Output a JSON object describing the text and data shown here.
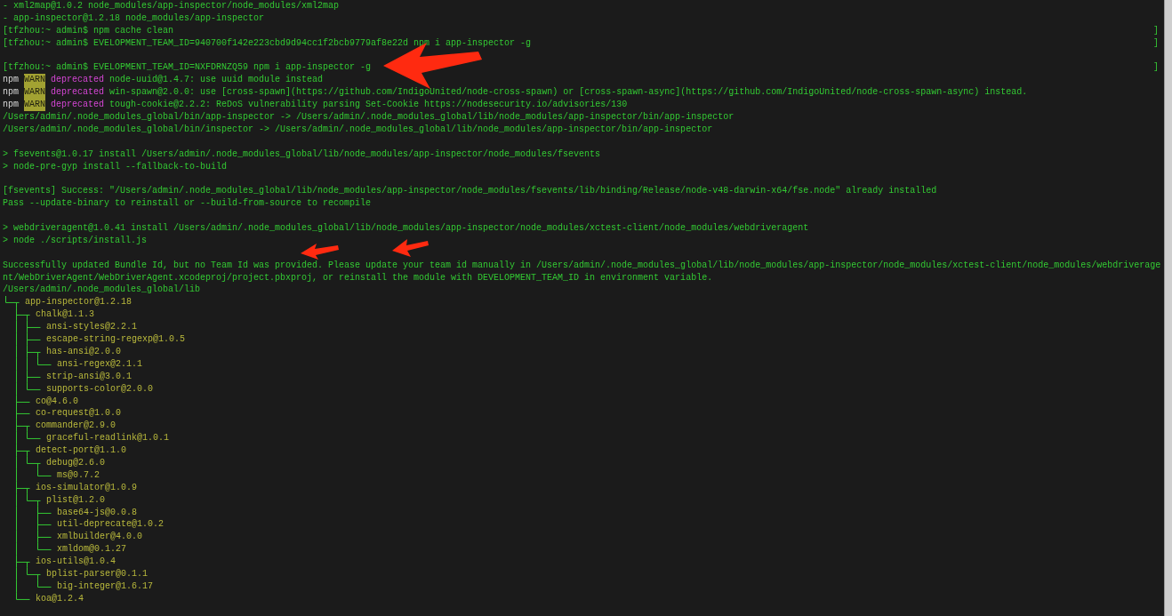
{
  "terminal": {
    "lines": [
      {
        "kind": "output",
        "text": "- xml2map@1.0.2 node_modules/app-inspector/node_modules/xml2map"
      },
      {
        "kind": "output",
        "text": "- app-inspector@1.2.18 node_modules/app-inspector"
      },
      {
        "kind": "prompt",
        "text": "[tfzhou:~ admin$ npm cache clean",
        "edge_mark": "]"
      },
      {
        "kind": "prompt",
        "text": "[tfzhou:~ admin$ EVELOPMENT_TEAM_ID=940700f142e223cbd9d94cc1f2bcb9779af8e22d npm i app-inspector -g",
        "edge_mark": "]"
      },
      {
        "kind": "blank"
      },
      {
        "kind": "prompt",
        "text": "[tfzhou:~ admin$ EVELOPMENT_TEAM_ID=NXFDRNZQ59 npm i app-inspector -g",
        "edge_mark": "]"
      },
      {
        "kind": "warn",
        "source": "npm",
        "level": "WARN",
        "tag": "deprecated",
        "text": "node-uuid@1.4.7: use uuid module instead"
      },
      {
        "kind": "warn",
        "source": "npm",
        "level": "WARN",
        "tag": "deprecated",
        "text": "win-spawn@2.0.0: use [cross-spawn](https://github.com/IndigoUnited/node-cross-spawn) or [cross-spawn-async](https://github.com/IndigoUnited/node-cross-spawn-async) instead."
      },
      {
        "kind": "warn",
        "source": "npm",
        "level": "WARN",
        "tag": "deprecated",
        "text": "tough-cookie@2.2.2: ReDoS vulnerability parsing Set-Cookie https://nodesecurity.io/advisories/130"
      },
      {
        "kind": "output",
        "text": "/Users/admin/.node_modules_global/bin/app-inspector -> /Users/admin/.node_modules_global/lib/node_modules/app-inspector/bin/app-inspector"
      },
      {
        "kind": "output",
        "text": "/Users/admin/.node_modules_global/bin/inspector -> /Users/admin/.node_modules_global/lib/node_modules/app-inspector/bin/app-inspector"
      },
      {
        "kind": "blank"
      },
      {
        "kind": "output",
        "text": "> fsevents@1.0.17 install /Users/admin/.node_modules_global/lib/node_modules/app-inspector/node_modules/fsevents"
      },
      {
        "kind": "output",
        "text": "> node-pre-gyp install --fallback-to-build"
      },
      {
        "kind": "blank"
      },
      {
        "kind": "output",
        "text": "[fsevents] Success: \"/Users/admin/.node_modules_global/lib/node_modules/app-inspector/node_modules/fsevents/lib/binding/Release/node-v48-darwin-x64/fse.node\" already installed"
      },
      {
        "kind": "output",
        "text": "Pass --update-binary to reinstall or --build-from-source to recompile"
      },
      {
        "kind": "blank"
      },
      {
        "kind": "output",
        "text": "> webdriveragent@1.0.41 install /Users/admin/.node_modules_global/lib/node_modules/app-inspector/node_modules/xctest-client/node_modules/webdriveragent"
      },
      {
        "kind": "output",
        "text": "> node ./scripts/install.js"
      },
      {
        "kind": "blank"
      },
      {
        "kind": "output",
        "text": "Successfully updated Bundle Id, but no Team Id was provided. Please update your team id manually in /Users/admin/.node_modules_global/lib/node_modules/app-inspector/node_modules/xctest-client/node_modules/webdriverage"
      },
      {
        "kind": "output",
        "text": "nt/WebDriverAgent/WebDriverAgent.xcodeproj/project.pbxproj, or reinstall the module with DEVELOPMENT_TEAM_ID in environment variable."
      },
      {
        "kind": "output",
        "text": "/Users/admin/.node_modules_global/lib"
      }
    ],
    "tree": [
      {
        "name": "app-inspector@1.2.18",
        "children": [
          {
            "name": "chalk@1.1.3",
            "children": [
              {
                "name": "ansi-styles@2.2.1"
              },
              {
                "name": "escape-string-regexp@1.0.5"
              },
              {
                "name": "has-ansi@2.0.0",
                "children": [
                  {
                    "name": "ansi-regex@2.1.1"
                  }
                ]
              },
              {
                "name": "strip-ansi@3.0.1"
              },
              {
                "name": "supports-color@2.0.0"
              }
            ]
          },
          {
            "name": "co@4.6.0"
          },
          {
            "name": "co-request@1.0.0"
          },
          {
            "name": "commander@2.9.0",
            "children": [
              {
                "name": "graceful-readlink@1.0.1"
              }
            ]
          },
          {
            "name": "detect-port@1.1.0",
            "children": [
              {
                "name": "debug@2.6.0",
                "children": [
                  {
                    "name": "ms@0.7.2"
                  }
                ]
              }
            ]
          },
          {
            "name": "ios-simulator@1.0.9",
            "children": [
              {
                "name": "plist@1.2.0",
                "children": [
                  {
                    "name": "base64-js@0.0.8"
                  },
                  {
                    "name": "util-deprecate@1.0.2"
                  },
                  {
                    "name": "xmlbuilder@4.0.0"
                  },
                  {
                    "name": "xmldom@0.1.27"
                  }
                ]
              }
            ]
          },
          {
            "name": "ios-utils@1.0.4",
            "children": [
              {
                "name": "bplist-parser@0.1.1",
                "children": [
                  {
                    "name": "big-integer@1.6.17"
                  }
                ]
              }
            ]
          },
          {
            "name": "koa@1.2.4"
          }
        ]
      }
    ]
  }
}
